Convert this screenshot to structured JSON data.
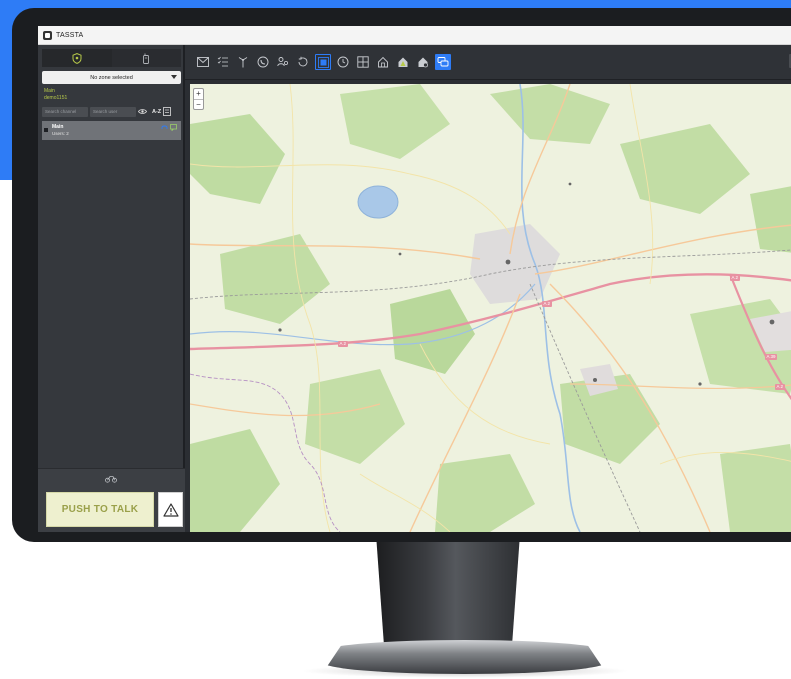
{
  "window": {
    "title": "TASSTA"
  },
  "sidebar": {
    "zone_select": {
      "value": "No zone selected"
    },
    "user": {
      "line1": "Main",
      "line2": "demo1151"
    },
    "search": {
      "channel_placeholder": "Search channel",
      "user_placeholder": "Search user",
      "sort_label": "A-Z"
    },
    "channel": {
      "name": "Main",
      "users": "Users: 2"
    }
  },
  "ptt": {
    "label": "PUSH TO TALK"
  },
  "map": {
    "zoom_in": "+",
    "zoom_out": "−",
    "road_labels": [
      "A 2",
      "A 2",
      "A 2",
      "A 2",
      "A 39"
    ]
  },
  "colors": {
    "accent": "#2e7cf6",
    "ptt_text": "#9aa04a",
    "user_text": "#b7c94a"
  }
}
